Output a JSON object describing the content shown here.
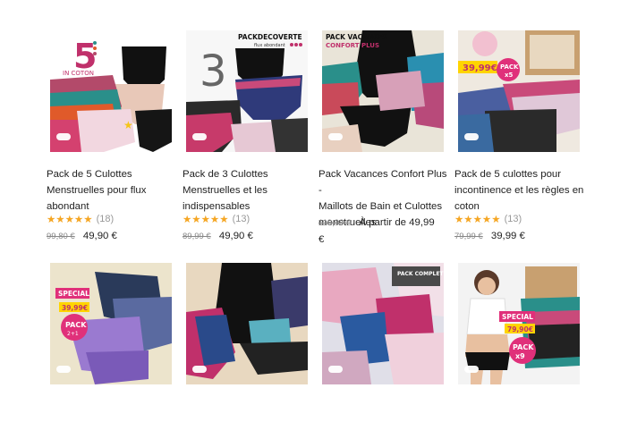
{
  "products": [
    {
      "title_lines": [
        "Pack de 5 Culottes",
        "Menstruelles pour flux",
        "abondant"
      ],
      "stars": "★★★★★",
      "reviews": "(18)",
      "old_price": "99,80 €",
      "price": "49,90 €",
      "image": {
        "badge_text": "5",
        "badge_sub": "IN COTON"
      }
    },
    {
      "title_lines": [
        "Pack de 3 Culottes",
        "Menstruelles et les",
        "indispensables"
      ],
      "stars": "★★★★★",
      "reviews": "(13)",
      "old_price": "89,99 €",
      "price": "49,90 €",
      "image": {
        "badge_text": "3",
        "badge_sub": "PACK DECOUVERTE",
        "badge_sub2": "flux abondant"
      }
    },
    {
      "title_lines": [
        "Pack Vacances Confort Plus -",
        "Maillots de Bain et Culottes",
        "menstruelles"
      ],
      "old_price": "119,99 €",
      "price_prefix": "À partir de 49,99",
      "price_suffix": "€",
      "image": {
        "badge_text": "PACK VACANCES",
        "badge_sub": "CONFORT PLUS"
      }
    },
    {
      "title_lines": [
        "Pack de 5 culottes pour",
        "incontinence et les règles en",
        "coton"
      ],
      "stars": "★★★★★",
      "reviews": "(13)",
      "old_price": "79,99 €",
      "price": "39,99 €",
      "image": {
        "badge_text": "39,99€",
        "badge_sub": "PACK",
        "badge_sub2": "x5"
      }
    },
    {
      "title_lines": [],
      "image": {
        "badge_text": "SPECIAL",
        "badge_sub": "39,99€",
        "badge_sub2": "PACK 2+1"
      }
    },
    {
      "title_lines": [],
      "image": {}
    },
    {
      "title_lines": [],
      "image": {
        "badge_text": "PACK COMPLET"
      }
    },
    {
      "title_lines": [],
      "image": {
        "badge_text": "SPECIAL",
        "badge_sub": "79,90€",
        "badge_sub2": "PACK x9"
      }
    }
  ],
  "colors": {
    "star": "#f5a623",
    "text": "#222222",
    "old_price": "#888888"
  }
}
